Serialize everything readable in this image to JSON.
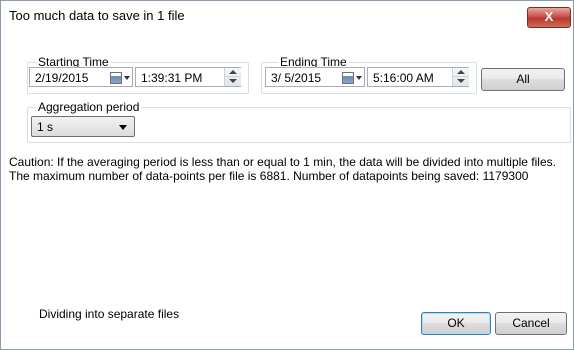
{
  "window": {
    "title": "Too much data to save in 1 file",
    "close_label": "X"
  },
  "starting": {
    "label": "Starting Time",
    "date": "2/19/2015",
    "time": "1:39:31 PM"
  },
  "ending": {
    "label": "Ending Time",
    "date": "3/ 5/2015",
    "time": "5:16:00 AM"
  },
  "all_button": "All",
  "aggregation": {
    "label": "Aggregation period",
    "selected": "1 s"
  },
  "caution_text": "Caution: If the averaging period is less than or equal to 1 min, the data will be divided into multiple files. The maximum number of data-points per file is 6881. Number of datapoints being saved: 1179300",
  "status_text": "Dividing into separate files",
  "ok_button": "OK",
  "cancel_button": "Cancel"
}
